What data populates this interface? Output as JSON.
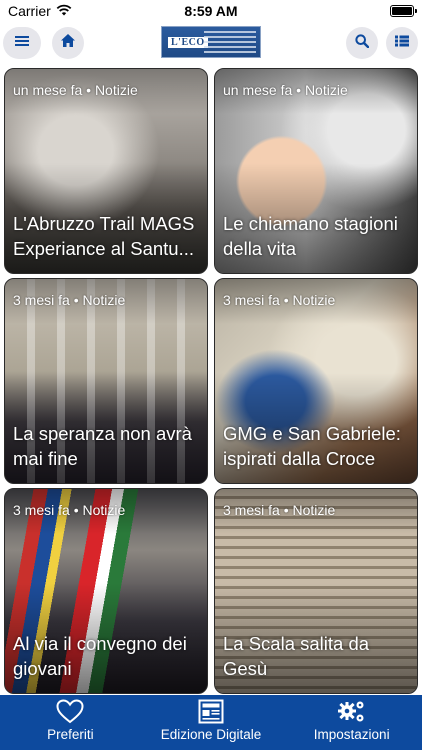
{
  "status_bar": {
    "carrier": "Carrier",
    "time": "8:59 AM"
  },
  "nav": {
    "menu_icon": "hamburger-menu-icon",
    "home_icon": "home-icon",
    "logo_text": "L'ECO",
    "search_icon": "search-icon",
    "list_icon": "list-icon"
  },
  "articles": [
    {
      "meta": "un mese fa • Notizie",
      "title": "L'Abruzzo Trail MAGS Experiance al Santu..."
    },
    {
      "meta": "un mese fa • Notizie",
      "title": "Le chiamano stagioni della vita"
    },
    {
      "meta": "3 mesi fa • Notizie",
      "title": "La speranza non avrà mai fine"
    },
    {
      "meta": "3 mesi fa • Notizie",
      "title": "GMG e San Gabriele: ispirati dalla Croce"
    },
    {
      "meta": "3 mesi fa • Notizie",
      "title": "Al via il convegno dei giovani"
    },
    {
      "meta": "3 mesi fa • Notizie",
      "title": "La Scala salita da Gesù"
    }
  ],
  "tabs": [
    {
      "label": "Preferiti",
      "icon": "heart-icon"
    },
    {
      "label": "Edizione Digitale",
      "icon": "newspaper-icon"
    },
    {
      "label": "Impostazioni",
      "icon": "gears-icon"
    }
  ],
  "colors": {
    "tab_bar": "#0d4a9e",
    "nav_button_bg": "#e6e6eb",
    "nav_icon": "#0d4a9e"
  }
}
